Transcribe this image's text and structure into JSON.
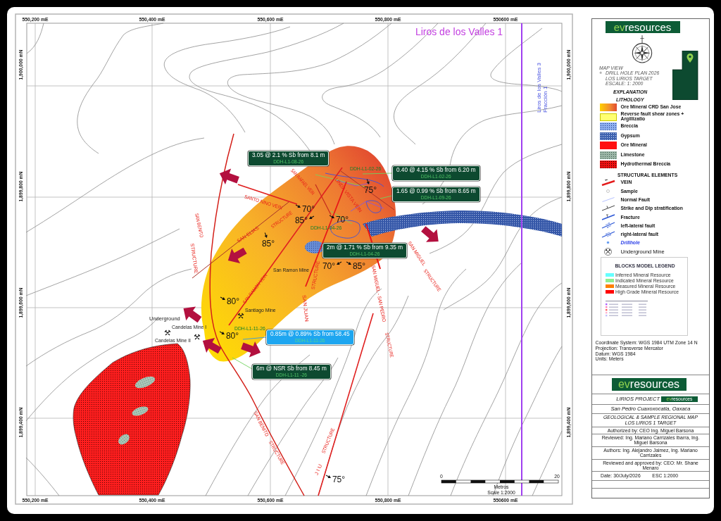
{
  "map": {
    "region_label": "Liros de los Valles 1",
    "parcel_labels": [
      "Liros de los Valles 3",
      "Fracción 1"
    ],
    "easting_top": [
      "550,200 mE",
      "550,400 mE",
      "550,600 mE",
      "550,800 mE",
      "550600 mE"
    ],
    "easting_bottom": [
      "550,200 mE",
      "550,400 mE",
      "550,600 mE",
      "550,800 mE",
      "550600 mE"
    ],
    "northing_left": [
      "1,900,000 mN",
      "1,899,800 mN",
      "1,899,600 mN",
      "1,899,400 mN"
    ],
    "northing_right": [
      "1,900,000 mN",
      "1,899,800 mN",
      "1,899,600 mN",
      "1,899,400 mN"
    ],
    "structure_labels": [
      "SAN RAFAEL VEIN",
      "LINDA VISTA VEIN",
      "SANTO NINO VEIN",
      "STRUCTURE",
      "SAN BENITO",
      "SAN ELIAS",
      "SAN MIGUEL",
      "STRUCTURE",
      "STRUCTURE",
      "STRUCTURE",
      "SAN RAMON VEIN",
      "SAN MIGUEL - SAN PEDRO",
      "SAN JUAN",
      "STRUCTURE",
      "SAN BENITO",
      "STRUCTURE",
      "STRUCTURE",
      "J I U"
    ],
    "dip_labels": [
      "75°",
      "70°",
      "70°",
      "85°",
      "85°",
      "85°",
      "70°",
      "80°",
      "80°",
      "75°"
    ],
    "place_labels": [
      "San Ramon Mine",
      "Santiago Mine",
      "Underground",
      "Candelas Mine I",
      "Candelas Mine II"
    ],
    "hole_labels": [
      "DDH-L1-02-26",
      "DDH-L1-04-26",
      "DDH-L1-11-26"
    ],
    "callouts": [
      {
        "text": "3.05 @ 2.1 % Sb from 8.1 m",
        "hole": "DDH-L1-08-26",
        "color": "#0d4a30"
      },
      {
        "text": "0.40 @ 4.15 % Sb from 6.20 m",
        "hole": "DDH-L1-02-26",
        "color": "#0d4a30"
      },
      {
        "text": "1.65 @ 0.99 % Sb from 8.65 m",
        "hole": "DDH-L1-09-26",
        "color": "#0d4a30"
      },
      {
        "text": "2m @ 1.71 % Sb from 9.35 m",
        "hole": "DDH-L1-04-26",
        "color": "#0d4a30"
      },
      {
        "text": "0.85m @ 0.89% Sb from 58.45",
        "hole": "DDH-L1-11-26",
        "color": "#1ea6f0"
      },
      {
        "text": "6m @ NSR Sb from 8.45 m",
        "hole": "DDH-L1-11 -26",
        "color": "#0d4a30"
      }
    ],
    "scale_bar": {
      "start": "0",
      "end": "20",
      "unit": "Metros",
      "scale": "Scale 1:2000"
    }
  },
  "legend": {
    "logo": {
      "prefix": "ev",
      "name": "resources"
    },
    "map_view": {
      "title": "MAP VIEW",
      "bullet": "+",
      "lines": [
        "DRILL HOLE PLAN 2026",
        "LOS LIRIOS TARGET",
        "ESCALE: 1: 2000"
      ]
    },
    "explanation": "EXPLANATION",
    "lithology": {
      "title": "LITHOLOGY",
      "items": [
        {
          "kind": "ore_gradient",
          "label": "Ore Mineral CRD San Jose"
        },
        {
          "kind": "fault_zone",
          "label": "Reverse fault shear zones + Argillizatio"
        },
        {
          "kind": "breccia",
          "label": "Breccia"
        },
        {
          "kind": "gypsum",
          "label": "Gypsum"
        },
        {
          "kind": "ore",
          "label": "Ore Mineral"
        },
        {
          "kind": "limestone",
          "label": "Limestone"
        },
        {
          "kind": "hydrothermal_breccia",
          "label": "Hydrothermal Breccia"
        }
      ]
    },
    "structural": {
      "title": "STRUCTURAL ELEMENTS",
      "items": [
        {
          "kind": "vein",
          "label": "VEIN"
        },
        {
          "kind": "sample",
          "label": "Sample"
        },
        {
          "kind": "normal_fault",
          "label": "Normal Fault"
        },
        {
          "kind": "strike_dip",
          "label": "Strike and Dip stratification"
        },
        {
          "kind": "fracture",
          "label": "Fracture"
        },
        {
          "kind": "left_lateral",
          "label": "left-lateral fault"
        },
        {
          "kind": "right_lateral",
          "label": "right-lateral fault"
        },
        {
          "kind": "drillhole",
          "label": "Drillhole"
        },
        {
          "kind": "mine",
          "label": "Underground Mine"
        }
      ]
    },
    "resource_legend": {
      "title": "BLOCKS MODEL LEGEND",
      "items": [
        {
          "label": "Inferred Mineral Resource",
          "color": "#66ffff"
        },
        {
          "label": "Indicated Mineral Resource",
          "color": "#90ee90"
        },
        {
          "label": "Measured Mineral Resource",
          "color": "#ff8000"
        },
        {
          "label": "High Grade Mineral Resource",
          "color": "#ff0000"
        }
      ]
    },
    "coordinate_info": [
      "Coordinate System: WGS 1984 UTM Zone 14 N",
      "Projection: Transverse Mercator",
      "Datum: WGS 1984",
      "Units: Meters"
    ]
  },
  "title_block": {
    "logo": {
      "prefix": "ev",
      "name": "resources"
    },
    "project": "LIRIOS PROJECT",
    "project_logo": {
      "prefix": "ev",
      "name": "resources"
    },
    "location": "San Pedro Cuaxoxocatla, Oaxaca",
    "map_title": "GEOLOGICAL & SAMPLE REGIONAL MAP",
    "target": "LOS LIRIOS 1 TARGET",
    "authorized": "Authorized by: CEO Ing. Miguel Barsona",
    "reviewed": "Reviewed: Ing. Mariano Carrizales Ibarra, Ing. Miguel Barsona",
    "authors": "Authors: Ing. Alejandro Jaimez, Ing. Mariano Carrizales",
    "approved": "Reviewed and approved by: CEO: Mr. Shane Menaro",
    "date": "Date: 30/July/2026",
    "scale": "ESC 1:2000"
  }
}
